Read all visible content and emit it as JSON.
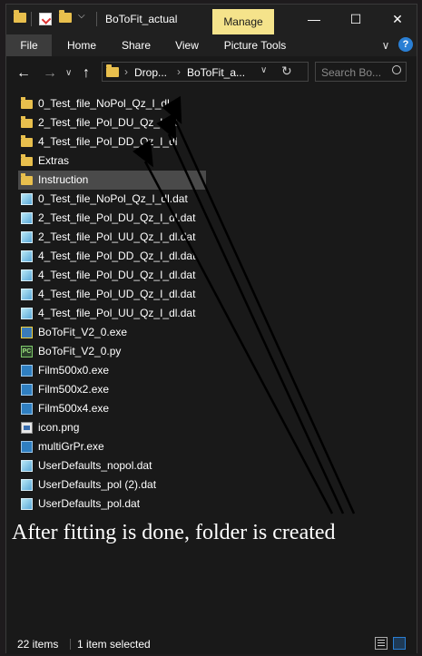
{
  "window": {
    "title": "BoToFit_actual",
    "context_tab": "Manage",
    "minimize_glyph": "—",
    "maximize_glyph": "☐",
    "close_glyph": "✕"
  },
  "ribbon": {
    "tabs": [
      "File",
      "Home",
      "Share",
      "View",
      "Picture Tools"
    ],
    "expand_glyph": "∨",
    "help_glyph": "?"
  },
  "navigation": {
    "back_glyph": "←",
    "forward_glyph": "→",
    "recent_glyph": "∨",
    "up_glyph": "↑",
    "breadcrumbs": [
      "Drop...",
      "BoToFit_a..."
    ],
    "search_placeholder": "Search Bo...",
    "search_icon": "search-icon",
    "refresh_icon": "refresh-icon"
  },
  "files": [
    {
      "name": "0_Test_file_NoPol_Qz_I_dl",
      "icon": "folder-icon",
      "selected": false
    },
    {
      "name": "2_Test_file_Pol_DU_Qz_I_dl",
      "icon": "folder-icon",
      "selected": false
    },
    {
      "name": "4_Test_file_Pol_DD_Qz_I_dl",
      "icon": "folder-icon",
      "selected": false
    },
    {
      "name": "Extras",
      "icon": "folder-icon",
      "selected": false
    },
    {
      "name": "Instruction",
      "icon": "folder-icon",
      "selected": true
    },
    {
      "name": "0_Test_file_NoPol_Qz_I_dl.dat",
      "icon": "dat-file-icon",
      "selected": false
    },
    {
      "name": "2_Test_file_Pol_DU_Qz_I_dl.dat",
      "icon": "dat-file-icon",
      "selected": false
    },
    {
      "name": "2_Test_file_Pol_UU_Qz_I_dl.dat",
      "icon": "dat-file-icon",
      "selected": false
    },
    {
      "name": "4_Test_file_Pol_DD_Qz_I_dl.dat",
      "icon": "dat-file-icon",
      "selected": false
    },
    {
      "name": "4_Test_file_Pol_DU_Qz_I_dl.dat",
      "icon": "dat-file-icon",
      "selected": false
    },
    {
      "name": "4_Test_file_Pol_UD_Qz_I_dl.dat",
      "icon": "dat-file-icon",
      "selected": false
    },
    {
      "name": "4_Test_file_Pol_UU_Qz_I_dl.dat",
      "icon": "dat-file-icon",
      "selected": false
    },
    {
      "name": "BoToFit_V2_0.exe",
      "icon": "python-exe-icon",
      "selected": false
    },
    {
      "name": "BoToFit_V2_0.py",
      "icon": "python-file-icon",
      "selected": false
    },
    {
      "name": "Film500x0.exe",
      "icon": "exe-file-icon",
      "selected": false
    },
    {
      "name": "Film500x2.exe",
      "icon": "exe-file-icon",
      "selected": false
    },
    {
      "name": "Film500x4.exe",
      "icon": "exe-file-icon",
      "selected": false
    },
    {
      "name": "icon.png",
      "icon": "png-image-icon",
      "selected": false
    },
    {
      "name": "multiGrPr.exe",
      "icon": "exe-file-icon",
      "selected": false
    },
    {
      "name": "UserDefaults_nopol.dat",
      "icon": "dat-file-icon",
      "selected": false
    },
    {
      "name": "UserDefaults_pol (2).dat",
      "icon": "dat-file-icon",
      "selected": false
    },
    {
      "name": "UserDefaults_pol.dat",
      "icon": "dat-file-icon",
      "selected": false
    }
  ],
  "annotation": {
    "text": "After fitting is done, folder is created"
  },
  "status_bar": {
    "item_count": "22 items",
    "selection": "1 item selected",
    "details_view_icon": "details-view-icon",
    "large_icons_view_icon": "large-icons-view-icon"
  },
  "colors": {
    "background": "#191919",
    "manage_tab": "#f5e38b",
    "folder": "#e8bf4d",
    "selection": "#4a4a4a",
    "help_button": "#2a7fd4"
  }
}
